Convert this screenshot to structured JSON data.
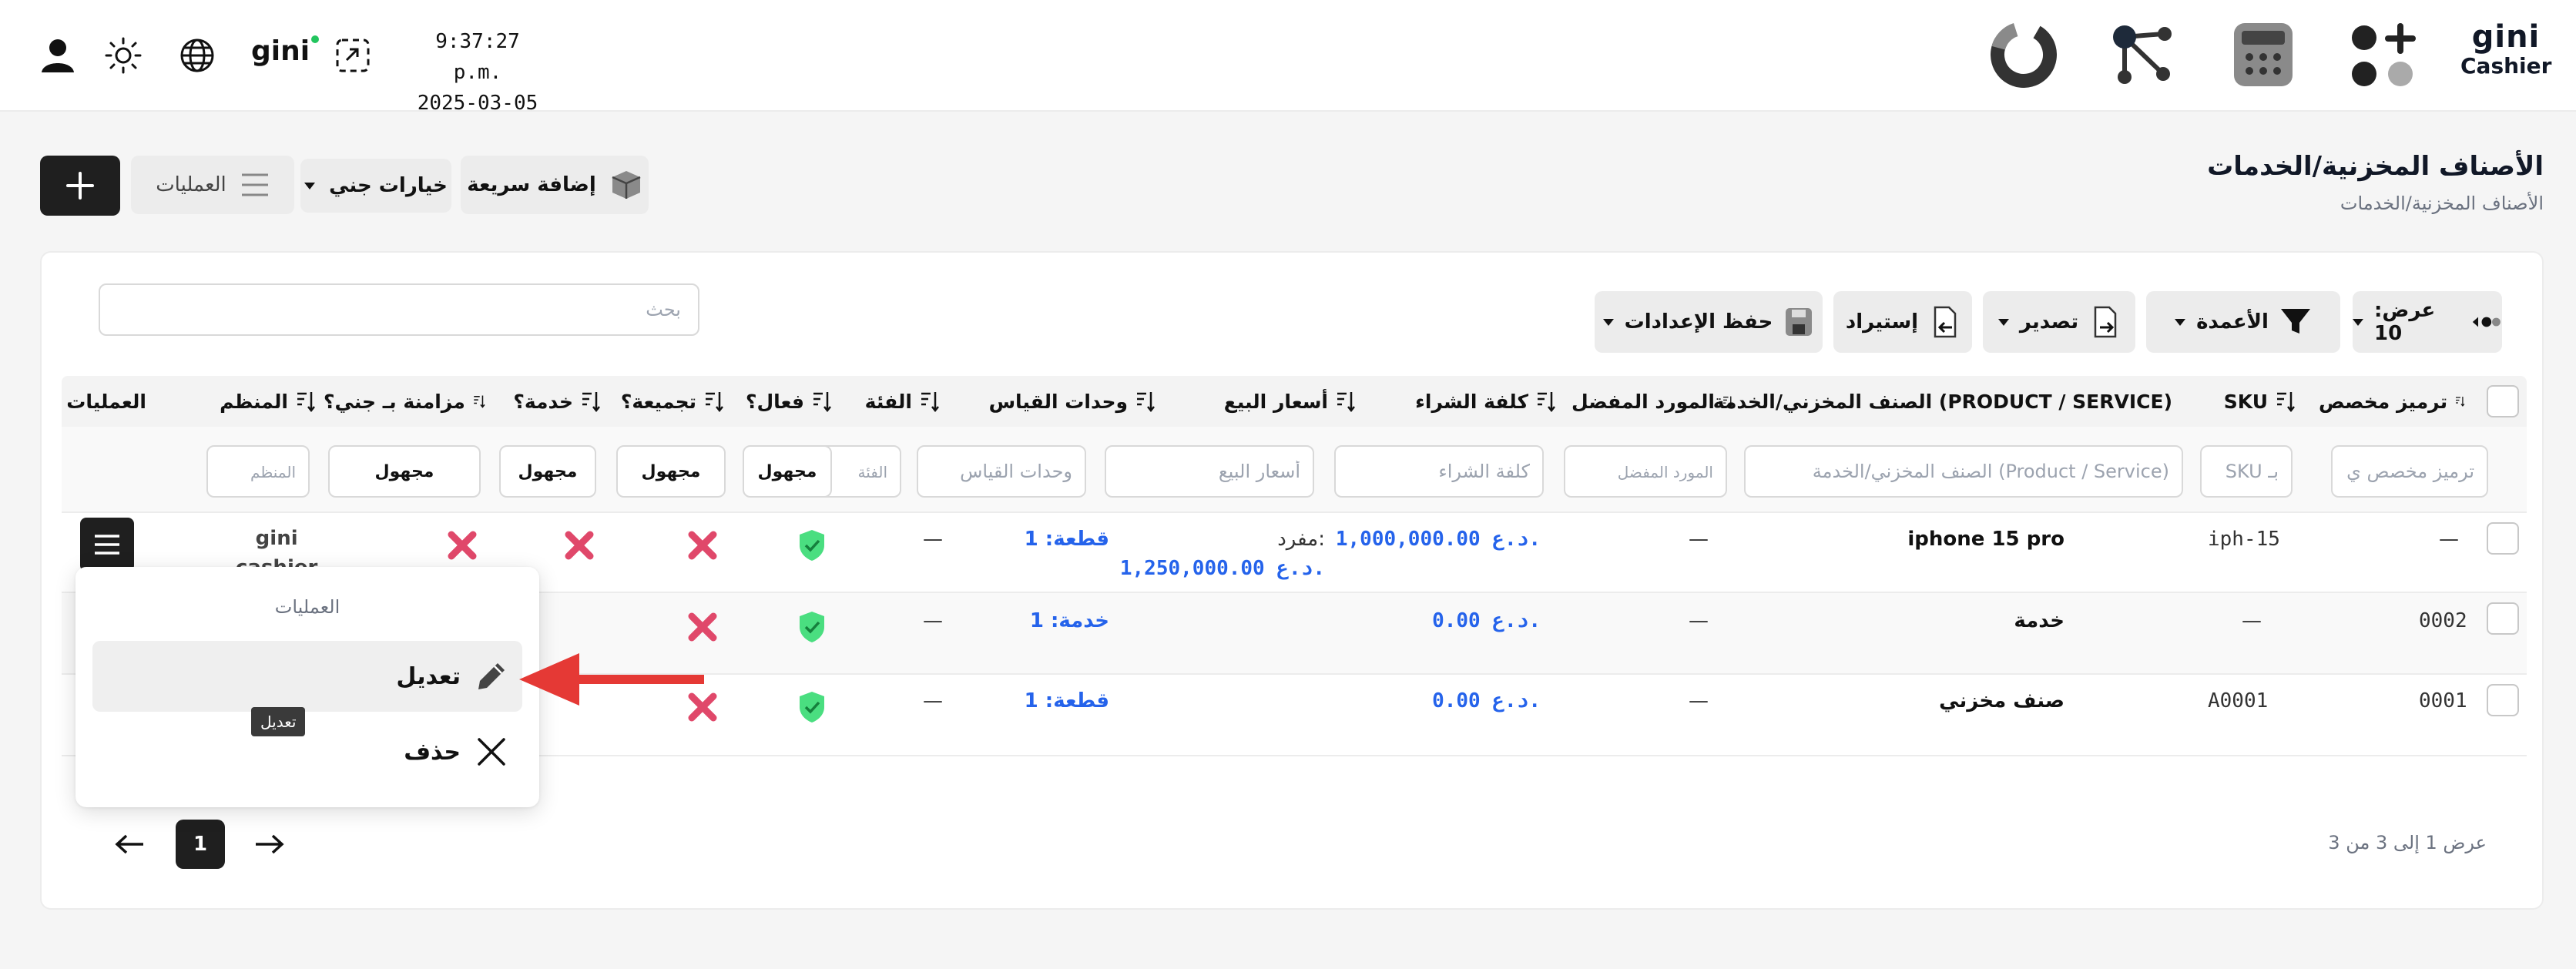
{
  "header": {
    "time": "9:37:27 p.m.",
    "date": "2025-03-05",
    "brand_top": "gini",
    "brand_bottom": "Cashier",
    "small_logo": "gini",
    "left_icons": [
      "user-icon",
      "sun-icon",
      "globe-icon",
      "gini-logo",
      "fullscreen-icon"
    ],
    "right_icons": [
      "chart-icon",
      "network-icon",
      "calculator-icon",
      "apps-icon"
    ]
  },
  "page": {
    "title": "الأصناف المخزنية/الخدمات",
    "breadcrumb": "الأصناف المخزنية/الخدمات",
    "quick_add": "إضافة سريعة",
    "gini_options": "خيارات جني",
    "operations": "العمليات"
  },
  "toolbar": {
    "show": "عرض: 10",
    "columns": "الأعمدة",
    "export": "تصدير",
    "import": "إستيراد",
    "save_settings": "حفظ الإعدادات",
    "search_placeholder": "بحث"
  },
  "columns": {
    "custom_code": "ترميز مخصص",
    "sku": "SKU",
    "item": "الصنف المخزني/الخدمة (PRODUCT / SERVICE)",
    "supplier": "المورد المفضل",
    "cost": "كلفة الشراء",
    "prices": "أسعار البيع",
    "units": "وحدات القياس",
    "category": "الفئة",
    "active": "فعال؟",
    "bundle": "تجميعة؟",
    "service": "خدمة؟",
    "synced": "مزامنة بـ جني؟",
    "organizer": "المنظم",
    "operations": "العمليات"
  },
  "filters": {
    "custom_code": "ترميز مخصص ي",
    "sku": "SKU بـ",
    "item": "الصنف المخزني/الخدمة (Product / Service)",
    "supplier": "المورد المفضل",
    "cost": "كلفة الشراء",
    "prices": "أسعار البيع",
    "units": "وحدات القياس",
    "category": "الفئة",
    "active": "مجهول",
    "bundle": "مجهول",
    "service": "مجهول",
    "synced": "مجهول",
    "organizer": "المنظم"
  },
  "rows": [
    {
      "code": "—",
      "sku": "iph-15",
      "item": "iphone 15 pro",
      "supplier": "—",
      "cost": "1,000,000.00 د.ع.",
      "price_label": "مفرد:",
      "price": "1,250,000.00 د.ع.",
      "units": "قطعة: 1",
      "category": "—",
      "organizer_1": "gini",
      "organizer_2": "cashier"
    },
    {
      "code": "0002",
      "sku": "—",
      "item": "خدمة",
      "supplier": "—",
      "cost": "0.00 د.ع.",
      "units": "خدمة: 1",
      "category": "—"
    },
    {
      "code": "0001",
      "sku": "A0001",
      "item": "صنف مخزني",
      "supplier": "—",
      "cost": "0.00 د.ع.",
      "units": "قطعة: 1",
      "category": "—"
    }
  ],
  "menu": {
    "title": "العمليات",
    "edit": "تعديل",
    "delete": "حذف",
    "tooltip": "تعديل"
  },
  "pagination": {
    "summary": "عرض 1 إلى 3 من 3",
    "current": "1"
  },
  "colors": {
    "primary_dark": "#1f1f1f",
    "link_blue": "#2563eb",
    "check_green": "#4ade80",
    "cross_red": "#e0486a",
    "arrow_red": "#e53935"
  }
}
